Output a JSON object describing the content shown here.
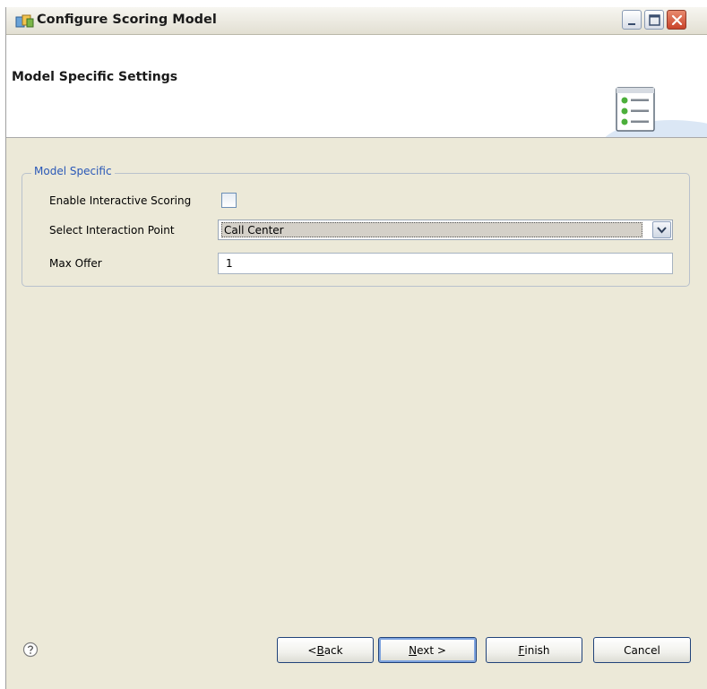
{
  "window": {
    "title": "Configure Scoring Model",
    "controls": [
      "minimize-icon",
      "maximize-icon",
      "close-icon"
    ]
  },
  "banner": {
    "title": "Model Specific Settings",
    "icon": "settings-list-icon"
  },
  "model_specific": {
    "group_label": "Model Specific",
    "enable_interactive_scoring": {
      "label": "Enable Interactive Scoring",
      "checked": false
    },
    "interaction_point": {
      "label": "Select Interaction Point",
      "value": "Call Center"
    },
    "max_offer": {
      "label": "Max Offer",
      "value": "1"
    }
  },
  "footer": {
    "help_icon": "question-mark-icon",
    "buttons": {
      "back": {
        "mnemonic": "B",
        "prefix": "< ",
        "rest": "ack"
      },
      "next": {
        "mnemonic": "N",
        "prefix": "",
        "rest": "ext >"
      },
      "finish": {
        "mnemonic": "F",
        "prefix": "",
        "rest": "inish"
      },
      "cancel": {
        "label": "Cancel"
      }
    }
  },
  "colors": {
    "dialog_bg": "#ece9d8",
    "group_legend": "#2a58b7",
    "button_border": "#21437a"
  }
}
